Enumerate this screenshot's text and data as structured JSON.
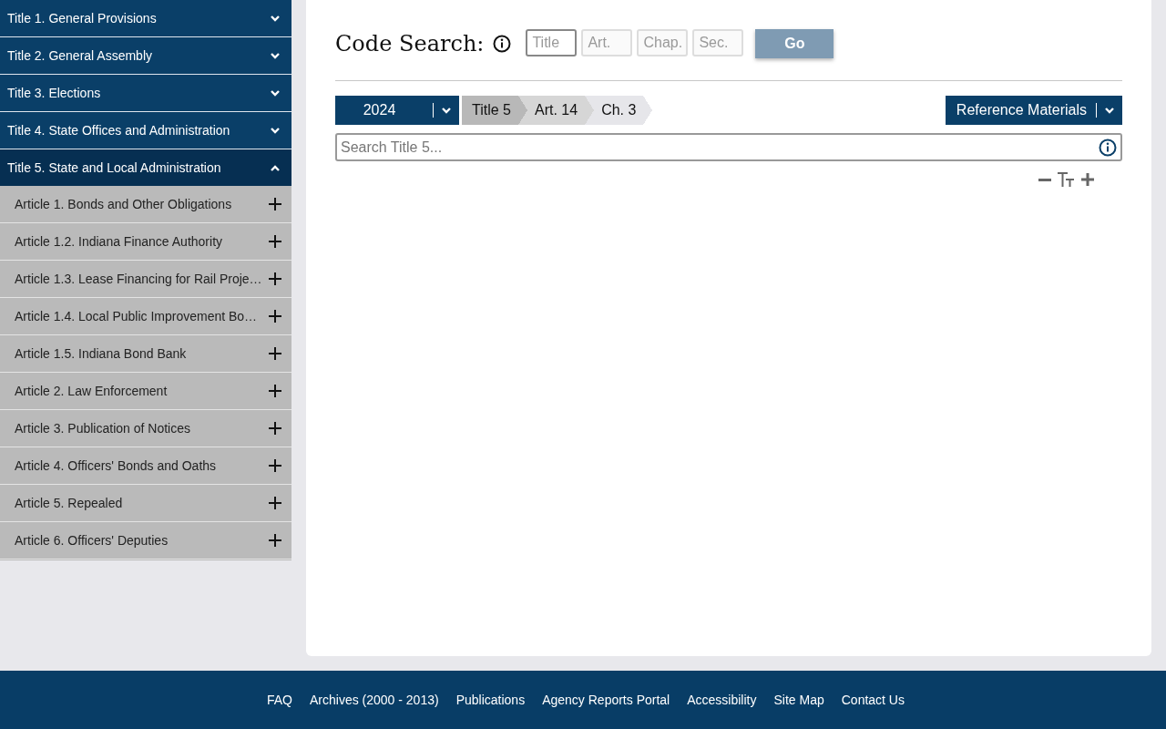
{
  "sidebar": {
    "titles": [
      {
        "label": "Title 1. General Provisions",
        "expanded": false
      },
      {
        "label": "Title 2. General Assembly",
        "expanded": false
      },
      {
        "label": "Title 3. Elections",
        "expanded": false
      },
      {
        "label": "Title 4. State Offices and Administration",
        "expanded": false
      },
      {
        "label": "Title 5. State and Local Administration",
        "expanded": true,
        "children": [
          {
            "label": "Article 1. Bonds and Other Obligations",
            "expanded": false
          },
          {
            "label": "Article 1.2. Indiana Finance Authority",
            "expanded": false
          },
          {
            "label": "Article 1.3. Lease Financing for Rail Proje…",
            "expanded": false
          },
          {
            "label": "Article 1.4. Local Public Improvement Bo…",
            "expanded": false
          },
          {
            "label": "Article 1.5. Indiana Bond Bank",
            "expanded": false
          },
          {
            "label": "Article 2. Law Enforcement",
            "expanded": false
          },
          {
            "label": "Article 3. Publication of Notices",
            "expanded": false
          },
          {
            "label": "Article 4. Officers' Bonds and Oaths",
            "expanded": false
          },
          {
            "label": "Article 5. Repealed",
            "expanded": false
          },
          {
            "label": "Article 6. Officers' Deputies",
            "expanded": false
          }
        ]
      }
    ]
  },
  "code_search": {
    "heading": "Code Search:",
    "fields": [
      {
        "placeholder": "Title",
        "focused": true
      },
      {
        "placeholder": "Art.",
        "focused": false
      },
      {
        "placeholder": "Chap.",
        "focused": false
      },
      {
        "placeholder": "Sec.",
        "focused": false
      }
    ],
    "go_button": "Go"
  },
  "breadcrumb": {
    "year": "2024",
    "crumbs": [
      {
        "label": "Title 5",
        "color": "#b8b8b8"
      },
      {
        "label": "Art. 14",
        "color": "#d6d6d6"
      },
      {
        "label": "Ch. 3",
        "color": "#e6e6ea"
      }
    ]
  },
  "reference_button": "Reference Materials",
  "title_search": {
    "placeholder": "Search Title 5..."
  },
  "footer": {
    "links": [
      "FAQ",
      "Archives (2000 - 2013)",
      "Publications",
      "Agency Reports Portal",
      "Accessibility",
      "Site Map",
      "Contact Us"
    ]
  }
}
